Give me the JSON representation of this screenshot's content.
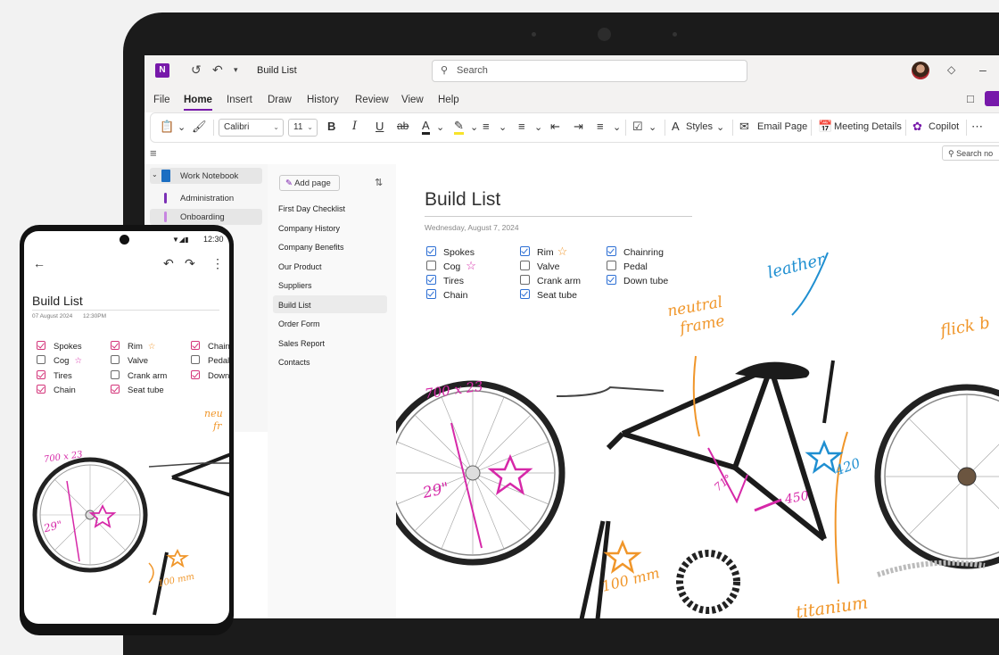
{
  "titlebar": {
    "title": "Build List",
    "search_placeholder": "Search"
  },
  "menu": [
    "File",
    "Home",
    "Insert",
    "Draw",
    "History",
    "Review",
    "View",
    "Help"
  ],
  "toolbar": {
    "font": "Calibri",
    "size": "11",
    "styles": "Styles",
    "email": "Email Page",
    "meeting": "Meeting Details",
    "copilot": "Copilot"
  },
  "page_search": "Search no",
  "notebook": {
    "name": "Work Notebook",
    "sections": [
      {
        "label": "Administration",
        "color": "#7a2fb5"
      },
      {
        "label": "Onboarding",
        "color": "#c785e0"
      }
    ]
  },
  "pages_pane": {
    "add_page": "Add page",
    "pages": [
      "First Day Checklist",
      "Company History",
      "Company Benefits",
      "Our Product",
      "Suppliers",
      "Build List",
      "Order Form",
      "Sales Report",
      "Contacts"
    ]
  },
  "note": {
    "title": "Build List",
    "date": "Wednesday, August 7, 2024",
    "checklist": [
      {
        "label": "Spokes",
        "checked": true
      },
      {
        "label": "Cog",
        "checked": false
      },
      {
        "label": "Tires",
        "checked": true
      },
      {
        "label": "Chain",
        "checked": true
      },
      {
        "label": "Rim",
        "checked": true
      },
      {
        "label": "Valve",
        "checked": false
      },
      {
        "label": "Crank arm",
        "checked": false
      },
      {
        "label": "Seat tube",
        "checked": true
      },
      {
        "label": "Chainring",
        "checked": true
      },
      {
        "label": "Pedal",
        "checked": false
      },
      {
        "label": "Down tube",
        "checked": true
      }
    ],
    "annotations": {
      "size": "700 x 23",
      "wheel": "29\"",
      "neutral": "neutral",
      "frame": "frame",
      "leather": "leather",
      "flick": "flick b",
      "angle": "71°",
      "tube": "450",
      "seat": "420",
      "crank": "100 mm",
      "titanium": "titanium"
    }
  },
  "phone": {
    "time": "12:30",
    "title": "Build List",
    "date": "07 August 2024",
    "time_stamp": "12:30PM",
    "checklist": [
      {
        "label": "Spokes",
        "checked": true
      },
      {
        "label": "Cog",
        "checked": false
      },
      {
        "label": "Tires",
        "checked": true
      },
      {
        "label": "Chain",
        "checked": true
      },
      {
        "label": "Rim",
        "checked": true
      },
      {
        "label": "Valve",
        "checked": false
      },
      {
        "label": "Crank arm",
        "checked": false
      },
      {
        "label": "Seat tube",
        "checked": true
      },
      {
        "label": "Chain",
        "checked": true
      },
      {
        "label": "Pedal",
        "checked": false
      },
      {
        "label": "Down",
        "checked": true
      }
    ],
    "annotations": {
      "size": "700 x 23",
      "wheel": "29\"",
      "neu": "neu",
      "fr": "fr",
      "crank": "100 mm"
    }
  },
  "colors": {
    "accent": "#7719aa",
    "check_blue": "#2d6fd4",
    "check_pink": "#d4367b",
    "ink_pink": "#d628a8",
    "ink_orange": "#f0962a",
    "ink_blue": "#1f8fd1"
  }
}
